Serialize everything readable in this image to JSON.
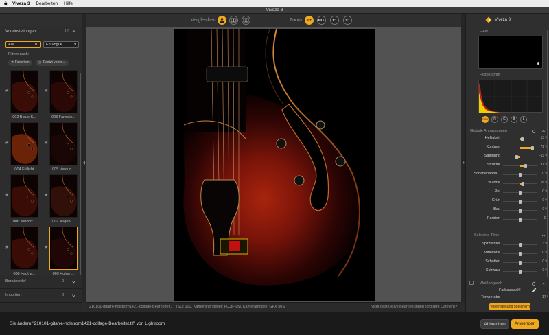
{
  "menubar": {
    "app": "Viveza 3",
    "items": [
      "Bearbeiten",
      "Hilfe"
    ]
  },
  "window": {
    "title": "Viveza 3"
  },
  "left": {
    "presets_title": "Voreinstellungen",
    "presets_count": "10",
    "seg_all_label": "Alle",
    "seg_all_count": "10",
    "seg_vogue_label": "En Vogue",
    "seg_vogue_count": "9",
    "filter_label": "Filtern nach:",
    "filter_fav": "Favoriten",
    "filter_recent": "Zuletzt verwe...",
    "thumbs": [
      {
        "caption": "002 Blaue S..."
      },
      {
        "caption": "003 Farbstic..."
      },
      {
        "caption": "004 Füllicht"
      },
      {
        "caption": "005 Verdun..."
      },
      {
        "caption": "006 Tonkorr..."
      },
      {
        "caption": "007 Augen ..."
      },
      {
        "caption": "008 Haut w..."
      },
      {
        "caption": "009 Hoher ..."
      }
    ],
    "user_defined_label": "Benutzerdef",
    "user_defined_count": "0",
    "imported_label": "Importiert",
    "imported_count": "0"
  },
  "center": {
    "compare_label": "Vergleichen",
    "zoom_label": "Zoom",
    "zoom_fit": "FIT",
    "zoom_fill": "FILL",
    "zoom_11": "1:1",
    "zoom_21": "2:1",
    "status_file": "210101-gitarre-holstrom1421-collage-Bearbeitet...",
    "status_meta": "ISO: 100, Kamerahersteller: FUJIFILM, Kameramodell: GFX 50S",
    "status_nondestructive": "Nicht destruktive Bearbeitungen (größere Dateien)"
  },
  "right": {
    "app_name": "Viveza 3",
    "loupe_label": "Lupe",
    "histogram_label": "Histogramm",
    "channels": [
      "RGB",
      "R",
      "G",
      "B",
      "L"
    ],
    "global_label": "Globale Anpassungen",
    "sliders": [
      {
        "label": "Helligkeit",
        "value": "13 %",
        "v": 13
      },
      {
        "label": "Kontrast",
        "value": "72 %",
        "v": 72
      },
      {
        "label": "Sättigung",
        "value": "-19 %",
        "v": -19
      },
      {
        "label": "Struktur",
        "value": "31 %",
        "v": 31
      },
      {
        "label": "Schattenanpa...",
        "value": "0 %",
        "v": 0
      },
      {
        "label": "Wärme",
        "value": "16 %",
        "v": 16
      },
      {
        "label": "Rot",
        "value": "0 %",
        "v": 0
      },
      {
        "label": "Grün",
        "value": "0 %",
        "v": 0
      },
      {
        "label": "Blau",
        "value": "0 %",
        "v": 0
      },
      {
        "label": "Farbton",
        "value": "0 °",
        "v": 0
      }
    ],
    "selective_label": "Selektive Töne",
    "tones": [
      {
        "label": "Spitzlichter",
        "value": "3 %",
        "v": 3
      },
      {
        "label": "Mitteltöne",
        "value": "0 %",
        "v": 0
      },
      {
        "label": "Schatten",
        "value": "0 %",
        "v": 0
      },
      {
        "label": "Schwarz",
        "value": "0 %",
        "v": 0
      }
    ],
    "wb_label": "Weißabgleich",
    "color_pick_label": "Farbauswahl",
    "temp_label": "Temperatur",
    "temp_value": "17 °",
    "save_preset_label": "Voreinstellung speichern"
  },
  "bottom": {
    "message": "Sie ändern \"210101-gitarre-holstrom1421-collage-Bearbeitet.tif\" von Lightroom",
    "cancel_label": "Abbrechen",
    "apply_label": "Anwenden"
  },
  "colors": {
    "accent": "#f0a81e",
    "panel": "#2f2f2f",
    "canvas": "#525252"
  }
}
